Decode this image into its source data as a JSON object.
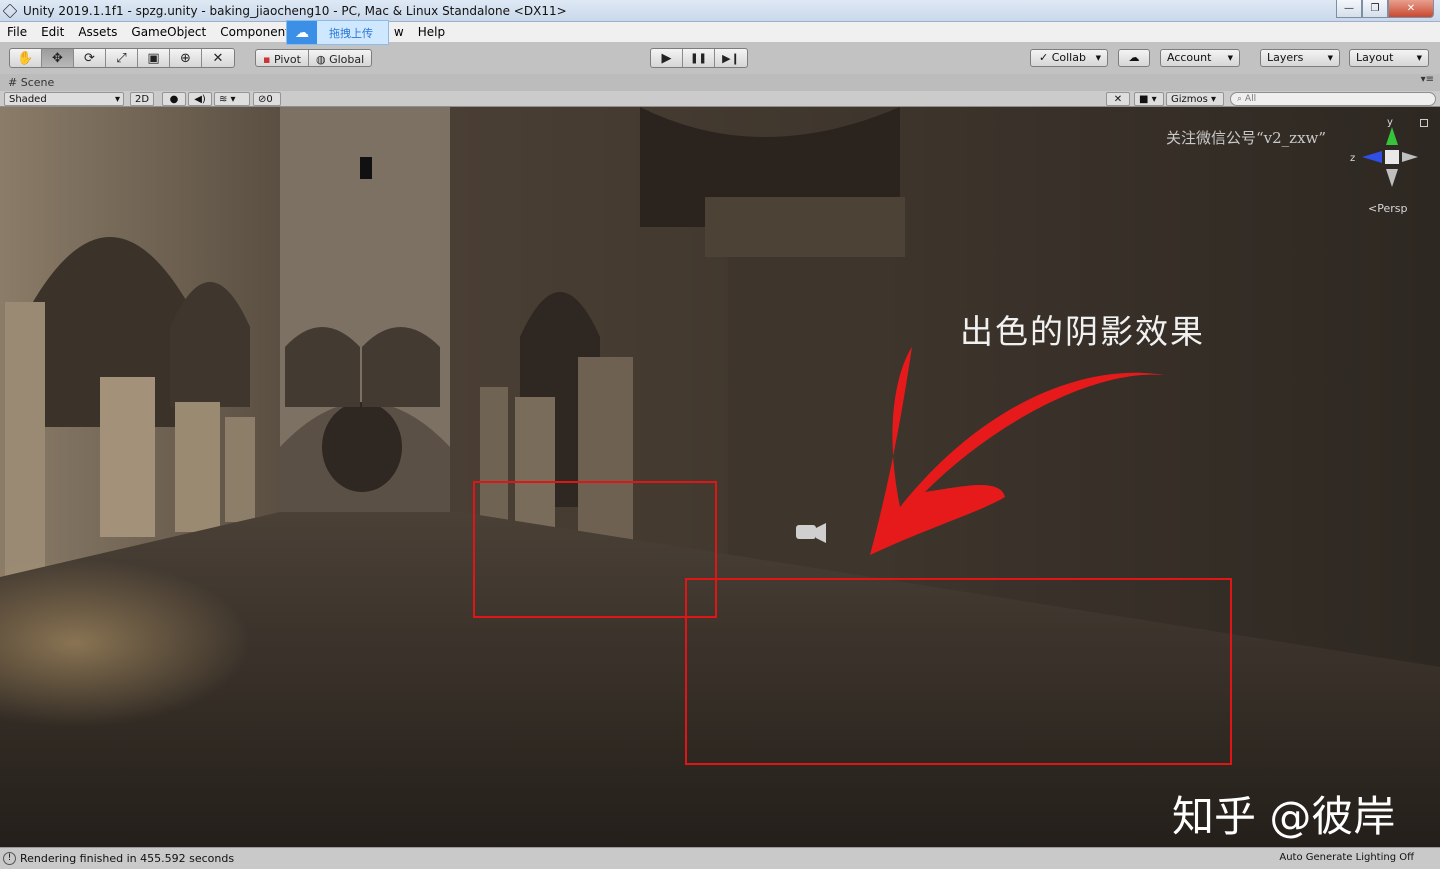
{
  "window": {
    "title": "Unity 2019.1.1f1 - spzg.unity - baking_jiaocheng10 - PC, Mac & Linux Standalone <DX11>",
    "minimize": "—",
    "restore": "❐",
    "close": "✕"
  },
  "menu": {
    "items": [
      "File",
      "Edit",
      "Assets",
      "GameObject",
      "Component",
      "w",
      "Help"
    ]
  },
  "upload_badge": {
    "label": "拖拽上传",
    "icon": "cloud-icon"
  },
  "toolbar": {
    "tools": [
      {
        "icon": "hand-icon",
        "glyph": "✋"
      },
      {
        "icon": "move-icon",
        "glyph": "✥"
      },
      {
        "icon": "rotate-icon",
        "glyph": "⟳"
      },
      {
        "icon": "scale-icon",
        "glyph": "⤢"
      },
      {
        "icon": "rect-icon",
        "glyph": "▣"
      },
      {
        "icon": "transform-icon",
        "glyph": "⊕"
      },
      {
        "icon": "custom-tool-icon",
        "glyph": "✕"
      }
    ],
    "pivot": "Pivot",
    "global": "Global",
    "play": "▶",
    "pause": "❚❚",
    "step": "▶❙",
    "collab": "Collab",
    "account": "Account",
    "layers": "Layers",
    "layout": "Layout"
  },
  "scene_tab": {
    "label": "Scene"
  },
  "scene_bar": {
    "shading": "Shaded",
    "mode2d": "2D",
    "fx_count": "0",
    "gizmos": "Gizmos",
    "search_placeholder": "All"
  },
  "viewport": {
    "watermark": "关注微信公号“v2_zxw”",
    "annotation": "出色的阴影效果",
    "credit": "知乎 @彼岸",
    "projection": "Persp",
    "axis_y": "y",
    "axis_z": "z"
  },
  "status": {
    "message": "Rendering finished in 455.592 seconds",
    "lighting": "Auto Generate Lighting Off"
  },
  "colors": {
    "highlight_box": "#e01515",
    "arrow": "#e61a1a",
    "toolbar_bg": "#c2c2c2"
  }
}
